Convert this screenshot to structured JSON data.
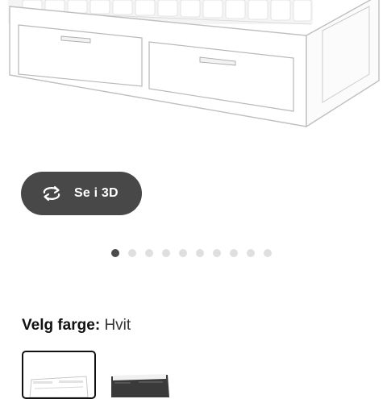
{
  "viewer": {
    "button_3d_label": "Se i 3D",
    "button_3d_icon": "rotate-360-icon"
  },
  "carousel": {
    "total_images": 10,
    "active_index": 0
  },
  "color_picker": {
    "label": "Velg farge:",
    "selected_value": "Hvit",
    "options": [
      {
        "name": "white-variant",
        "color": "#ffffff",
        "selected": true
      },
      {
        "name": "black-brown-variant",
        "color": "#3a3a3a",
        "selected": false
      }
    ]
  }
}
